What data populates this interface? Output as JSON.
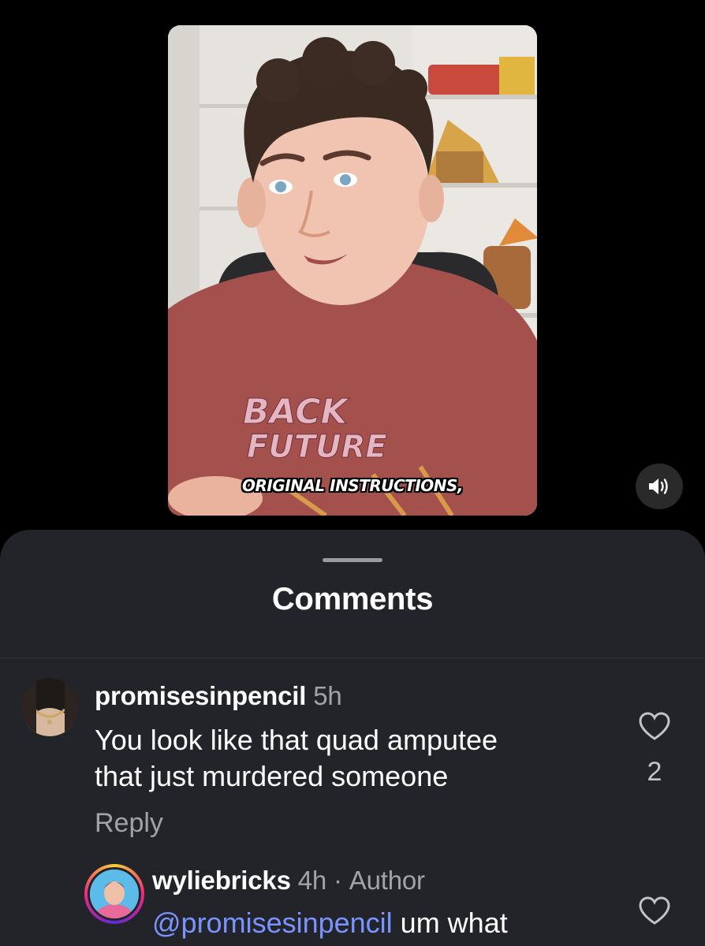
{
  "video": {
    "caption": "ORIGINAL INSTRUCTIONS,",
    "shirt_text": "BACK TO THE FUTURE"
  },
  "sound_icon": "speaker-volume-icon",
  "comments_sheet": {
    "title": "Comments",
    "comments": [
      {
        "username": "promisesinpencil",
        "time": "5h",
        "text_line1": "You look like that quad amputee",
        "text_line2": "that just murdered someone",
        "reply_label": "Reply",
        "likes": "2"
      },
      {
        "username": "wyliebricks",
        "time": "4h",
        "separator": "·",
        "badge": "Author",
        "mention": "@promisesinpencil",
        "text": " um what"
      }
    ]
  },
  "colors": {
    "background": "#000000",
    "sheet": "#23242a",
    "secondary_text": "#a2a3a9",
    "mention": "#7a94ff"
  }
}
